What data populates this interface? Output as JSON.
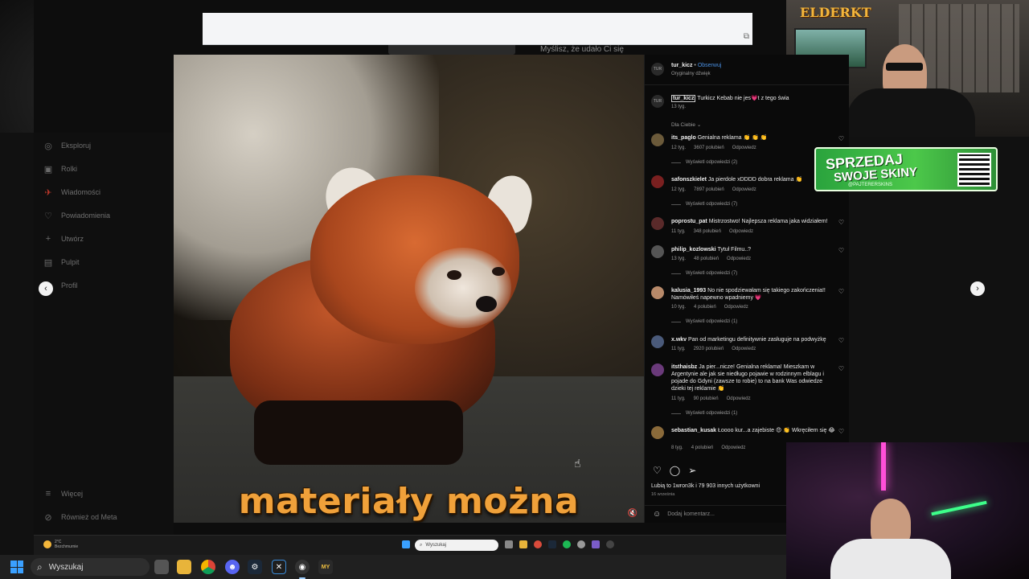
{
  "overlays": {
    "brand_logo": "ELDERKT"
  },
  "browser": {
    "hint_text": "Myślisz, że udało Ci się",
    "sidebar": {
      "items": [
        {
          "label": "Eksploruj",
          "icon": "compass-icon"
        },
        {
          "label": "Rolki",
          "icon": "reels-icon"
        },
        {
          "label": "Wiadomości",
          "icon": "messenger-icon"
        },
        {
          "label": "Powiadomienia",
          "icon": "heart-icon"
        },
        {
          "label": "Utwórz",
          "icon": "plus-icon"
        },
        {
          "label": "Pulpit",
          "icon": "dashboard-icon"
        },
        {
          "label": "Profil",
          "icon": "profile-icon"
        }
      ],
      "bottom_items": [
        {
          "label": "Więcej",
          "icon": "menu-icon"
        },
        {
          "label": "Również od Meta",
          "icon": "meta-icon"
        }
      ]
    },
    "video": {
      "subtitle": "materiały można"
    }
  },
  "reel": {
    "author": "tur_kicz",
    "follow_label": "Obserwuj",
    "audio": "Oryginalny dźwięk",
    "caption_author": "tur_kicz",
    "caption_text": "Turkicz Kebab nie jes💗t z tego świa",
    "caption_time": "13 tyg.",
    "filter_label": "Dla Ciebie",
    "comments": [
      {
        "user": "its_paglo",
        "text": "Genialna reklama 👏 👏 👏",
        "time": "12 tyg.",
        "likes": "3607 polubień",
        "reply": "Odpowiedz",
        "replies": "Wyświetl odpowiedzi (2)"
      },
      {
        "user": "safonszkielet",
        "text": "Ja pierdole xDDDD dobra reklama 👏",
        "time": "12 tyg.",
        "likes": "7897 polubień",
        "reply": "Odpowiedz",
        "replies": "Wyświetl odpowiedzi (7)"
      },
      {
        "user": "poprostu_pat",
        "text": "Mistrzostwo! Najlepsza reklama jaka widziałem!",
        "time": "11 tyg.",
        "likes": "348 polubień",
        "reply": "Odpowiedz",
        "replies": ""
      },
      {
        "user": "philip_kozlowski",
        "text": "Tytuł Filmu..?",
        "time": "13 tyg.",
        "likes": "48 polubień",
        "reply": "Odpowiedz",
        "replies": "Wyświetl odpowiedzi (7)"
      },
      {
        "user": "kalusia_1993",
        "text": "No nie spodziewałam się takiego zakończenia!! Namówiłeś napewno wpadniemy 💗",
        "time": "10 tyg.",
        "likes": "4 polubień",
        "reply": "Odpowiedz",
        "replies": "Wyświetl odpowiedzi (1)"
      },
      {
        "user": "x.wkv",
        "text": "Pan od marketingu definitywnie zasługuje na podwyżkę",
        "time": "11 tyg.",
        "likes": "2920 polubień",
        "reply": "Odpowiedz",
        "replies": ""
      },
      {
        "user": "itsthaisbz",
        "text": "Ja pier...nicze! Genialna reklama! Mieszkam w Argentynie ale jak sie niedługo pojawie w rodzinnym elblagu i pojade do Gdyni (zawsze to robie) to na bank Was odwiedze dzieki tej reklamie 👏",
        "time": "11 tyg.",
        "likes": "90 polubień",
        "reply": "Odpowiedz",
        "replies": "Wyświetl odpowiedzi (1)"
      },
      {
        "user": "sebastian_kusak",
        "text": "Łoooo kur...a zajebiste 😍 👏 Wkręciłem się 😂",
        "time": "8 tyg.",
        "likes": "4 polubień",
        "reply": "Odpowiedz",
        "replies": ""
      }
    ],
    "likes_text": "Lubią to 1wron3k i 79 903 innych użytkowni",
    "date": "16 września",
    "add_comment_placeholder": "Dodaj komentarz..."
  },
  "ad": {
    "line1": "SPRZEDAJ",
    "line2": "SWOJE SKINY",
    "handle": "@PAJTERERSKINS"
  },
  "inner_taskbar": {
    "weather_temp": "2°C",
    "weather_desc": "Bezchmurnie",
    "search_label": "Wyszukaj"
  },
  "taskbar": {
    "search_label": "Wyszukaj",
    "app_badge": "MY"
  },
  "colors": {
    "accent_blue": "#4a90e2",
    "subtitle_orange": "#f0a13a",
    "ad_green": "#4cc84a"
  }
}
